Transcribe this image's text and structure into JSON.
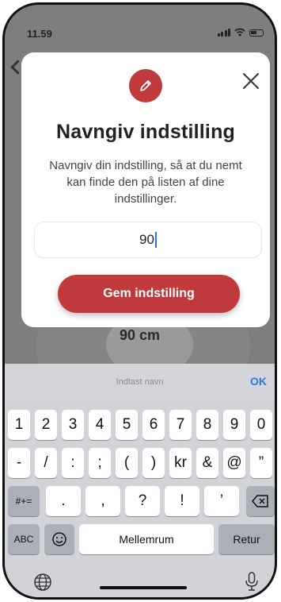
{
  "status": {
    "time": "11.59"
  },
  "background": {
    "value_label": "90 cm"
  },
  "dialog": {
    "title": "Navngiv indstilling",
    "description": "Navngiv din indstilling, så at du nemt kan finde den på listen af dine indstillinger.",
    "input_value": "90",
    "save_label": "Gem indstilling",
    "accent_color": "#c0393b"
  },
  "keyboard": {
    "hint": "Indtast navn",
    "ok_label": "OK",
    "row1": [
      "1",
      "2",
      "3",
      "4",
      "5",
      "6",
      "7",
      "8",
      "9",
      "0"
    ],
    "row2": [
      "-",
      "/",
      ":",
      ";",
      "(",
      ")",
      "kr",
      "&",
      "@",
      "”"
    ],
    "row3_left": "#+=",
    "row3": [
      ".",
      ",",
      "?",
      "!",
      "’"
    ],
    "abc_label": "ABC",
    "space_label": "Mellemrum",
    "return_label": "Retur"
  }
}
